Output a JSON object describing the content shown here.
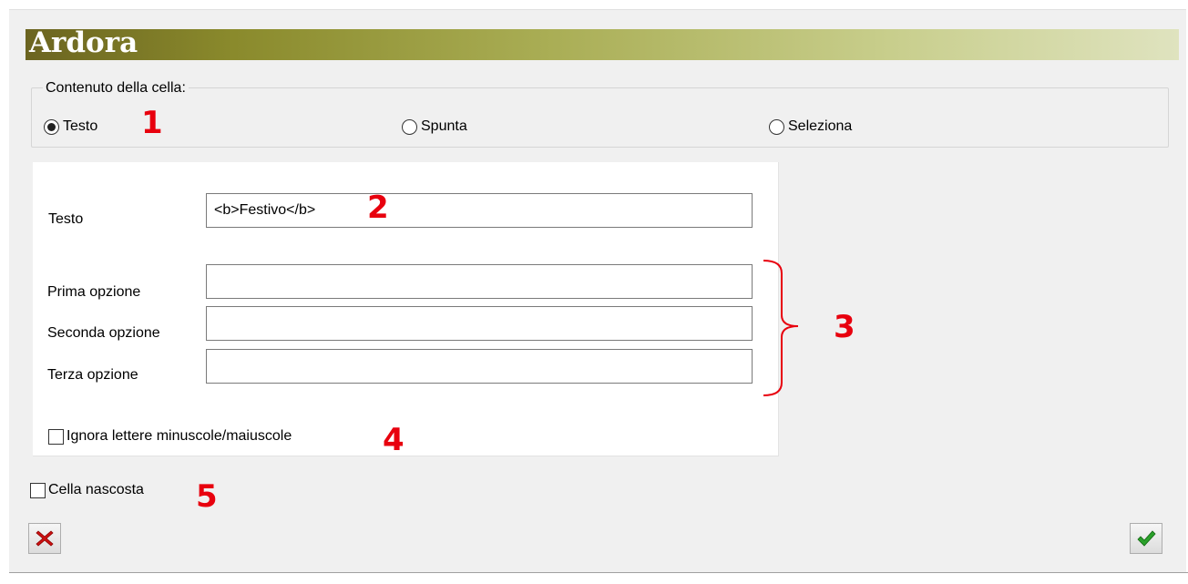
{
  "window": {
    "title": "Ardora"
  },
  "cell_content": {
    "legend": "Contenuto della cella:",
    "options": [
      {
        "label": "Testo",
        "checked": true
      },
      {
        "label": "Spunta",
        "checked": false
      },
      {
        "label": "Seleziona",
        "checked": false
      }
    ]
  },
  "text_panel": {
    "text_label": "Testo",
    "text_value": "<b>Festivo</b>",
    "first_option_label": "Prima opzione",
    "first_option_value": "",
    "second_option_label": "Seconda opzione",
    "second_option_value": "",
    "third_option_label": "Terza opzione",
    "third_option_value": "",
    "ignore_case_label": "Ignora lettere minuscole/maiuscole",
    "ignore_case_checked": false
  },
  "hidden_cell": {
    "label": "Cella nascosta",
    "checked": false
  },
  "buttons": {
    "cancel_icon": "red-x-icon",
    "ok_icon": "green-check-icon"
  },
  "annotations": [
    "1",
    "2",
    "3",
    "4",
    "5"
  ],
  "colors": {
    "annotation": "#e8000e",
    "title_start": "#6b6420",
    "title_end": "#dfe3bf"
  }
}
